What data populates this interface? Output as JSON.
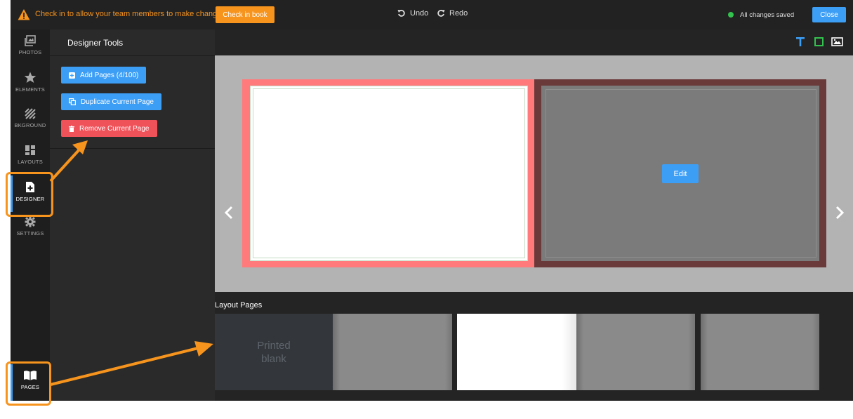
{
  "topbar": {
    "warning_text": "Check in to allow your team members to make changes",
    "checkin_label": "Check in book",
    "undo_label": "Undo",
    "redo_label": "Redo",
    "saved_text": "All changes saved",
    "close_label": "Close"
  },
  "nav": {
    "items": [
      {
        "label": "PHOTOS",
        "icon": "photos-icon"
      },
      {
        "label": "ELEMENTS",
        "icon": "star-icon"
      },
      {
        "label": "BKGROUND",
        "icon": "background-icon"
      },
      {
        "label": "LAYOUTS",
        "icon": "layouts-icon"
      },
      {
        "label": "DESIGNER",
        "icon": "designer-icon"
      },
      {
        "label": "SETTINGS",
        "icon": "gear-icon"
      }
    ],
    "pages_label": "PAGES"
  },
  "panel": {
    "title": "Designer Tools",
    "add_pages": "Add Pages (4/100)",
    "duplicate_page": "Duplicate Current Page",
    "remove_page": "Remove Current Page"
  },
  "canvas": {
    "edit_label": "Edit"
  },
  "layout_pages": {
    "title": "Layout Pages",
    "blank_label_line1": "Printed",
    "blank_label_line2": "blank"
  },
  "colors": {
    "accent": "#3d9ef5",
    "warning": "#f7941d",
    "danger": "#f0525a",
    "success": "#32c24d"
  }
}
